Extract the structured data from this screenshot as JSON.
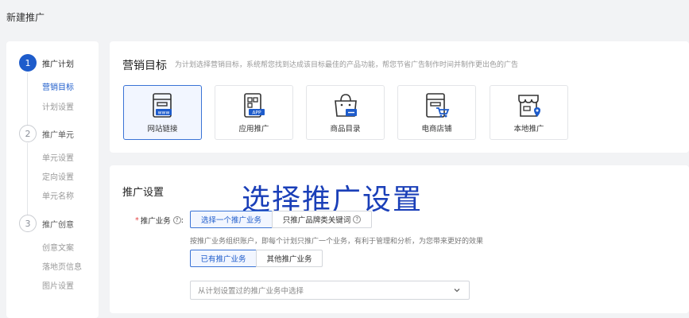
{
  "page": {
    "title": "新建推广"
  },
  "sidebar": {
    "steps": [
      {
        "num": "1",
        "label": "推广计划",
        "subs": [
          "营销目标",
          "计划设置"
        ]
      },
      {
        "num": "2",
        "label": "推广单元",
        "subs": [
          "单元设置",
          "定向设置",
          "单元名称"
        ]
      },
      {
        "num": "3",
        "label": "推广创意",
        "subs": [
          "创意文案",
          "落地页信息",
          "图片设置"
        ]
      }
    ]
  },
  "goal": {
    "title": "营销目标",
    "desc": "为计划选择营销目标，系统帮您找到达成该目标最佳的产品功能，帮您节省广告制作时间并制作更出色的广告",
    "options": [
      {
        "label": "网站链接",
        "icon": "website-icon",
        "badge": "www",
        "selected": true
      },
      {
        "label": "应用推广",
        "icon": "app-icon",
        "badge": "APP",
        "selected": false
      },
      {
        "label": "商品目录",
        "icon": "shopping-bag-icon",
        "selected": false
      },
      {
        "label": "电商店铺",
        "icon": "ecommerce-cart-icon",
        "selected": false
      },
      {
        "label": "本地推广",
        "icon": "local-store-icon",
        "selected": false
      }
    ]
  },
  "promo": {
    "title": "推广设置",
    "overlay": "选择推广设置",
    "business_label": "推广业务",
    "business_options": [
      "选择一个推广业务",
      "只推广品牌类关键词"
    ],
    "business_selected": 0,
    "hint": "按推广业务组织账户，即每个计划只推广一个业务，有利于管理和分析，为您带来更好的效果",
    "source_options": [
      "已有推广业务",
      "其他推广业务"
    ],
    "source_selected": 0,
    "select_placeholder": "从计划设置过的推广业务中选择"
  },
  "colors": {
    "primary": "#1e5ccb",
    "selected_bg": "#f2f6ff",
    "required": "#e54545"
  }
}
